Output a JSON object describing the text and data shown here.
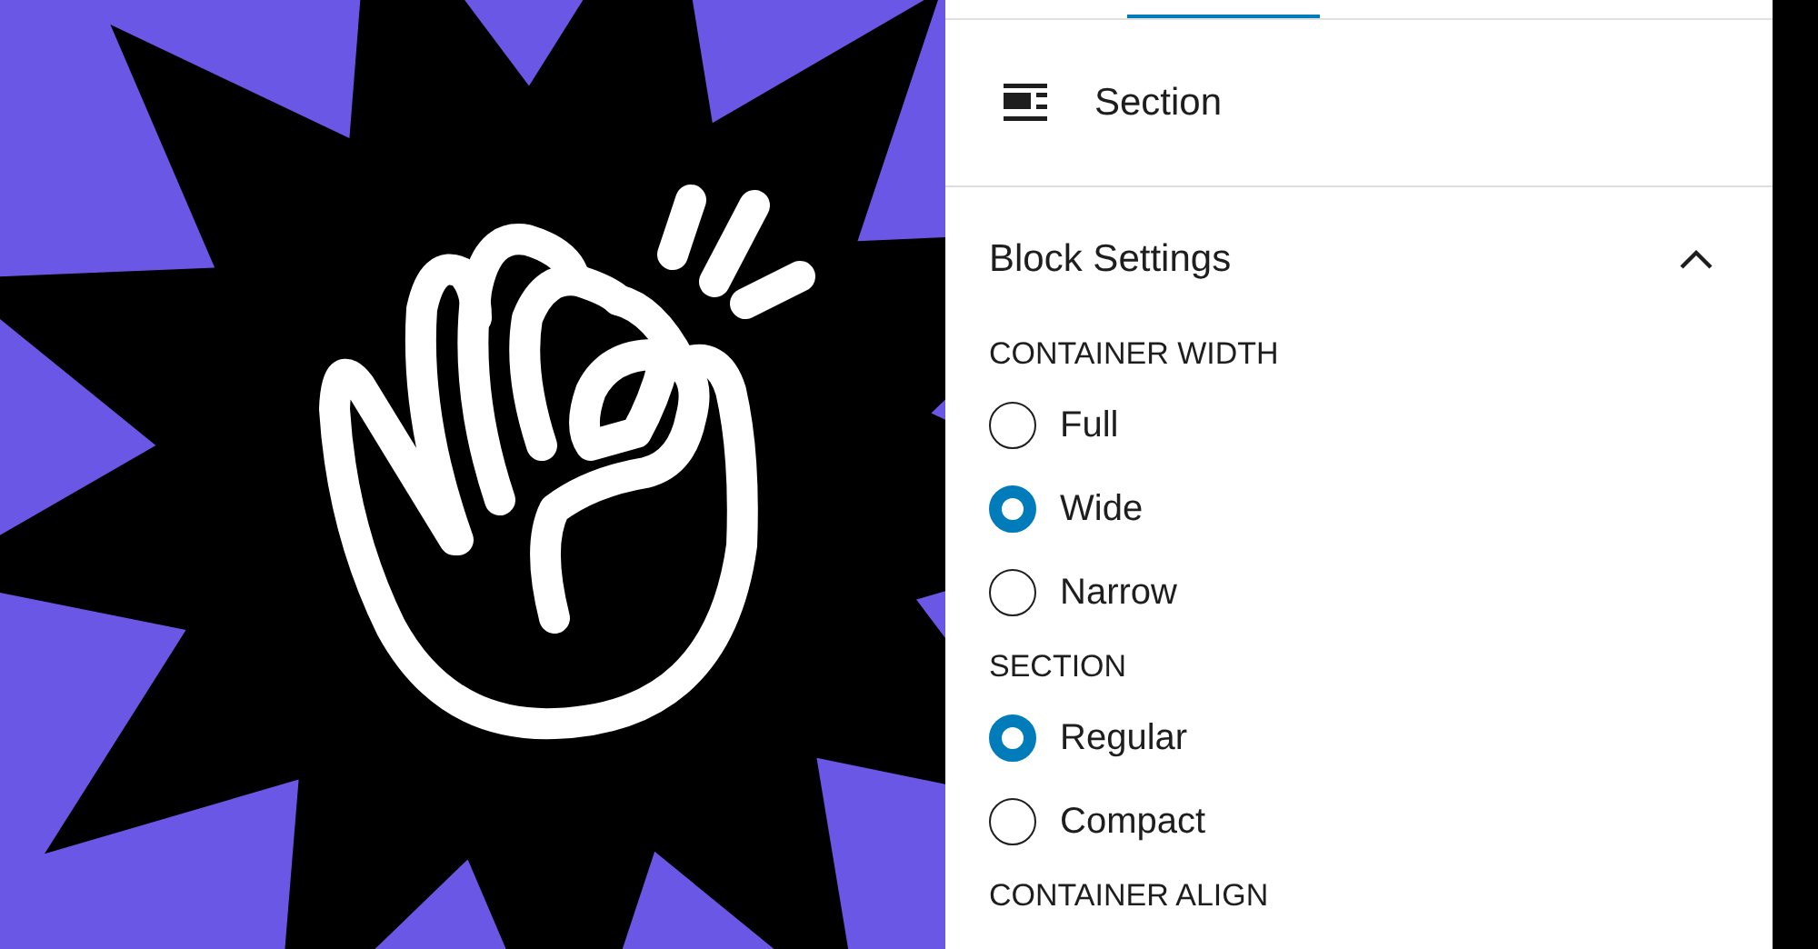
{
  "block": {
    "title": "Section"
  },
  "panel": {
    "title": "Block Settings",
    "expanded": true
  },
  "groups": [
    {
      "label": "CONTAINER WIDTH",
      "options": [
        {
          "label": "Full",
          "selected": false
        },
        {
          "label": "Wide",
          "selected": true
        },
        {
          "label": "Narrow",
          "selected": false
        }
      ]
    },
    {
      "label": "SECTION",
      "options": [
        {
          "label": "Regular",
          "selected": true
        },
        {
          "label": "Compact",
          "selected": false
        }
      ]
    },
    {
      "label": "CONTAINER ALIGN"
    }
  ]
}
